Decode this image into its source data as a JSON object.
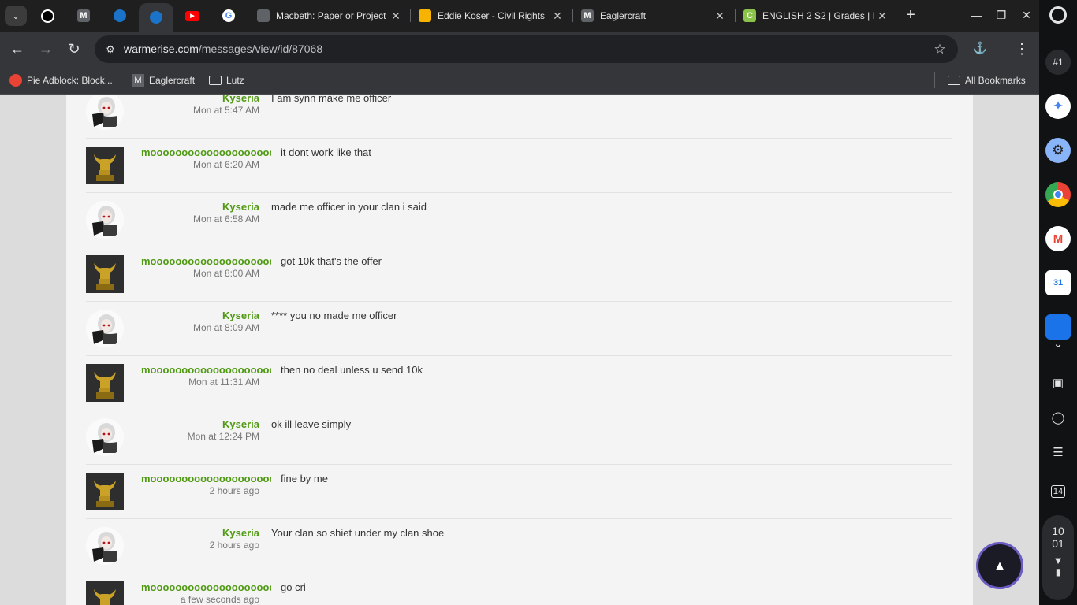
{
  "tabs": [
    {
      "title": "Macbeth: Paper or Project",
      "favicon": "classroom-icon"
    },
    {
      "title": "Eddie Koser - Civil Rights",
      "favicon": "slides-icon"
    },
    {
      "title": "Eaglercraft",
      "favicon": "eaglercraft-icon"
    },
    {
      "title": "ENGLISH 2 S2 | Grades | I",
      "favicon": "canvas-icon"
    }
  ],
  "address": {
    "host": "warmerise.com",
    "path": "/messages/view/id/87068"
  },
  "bookmarks": [
    {
      "label": "Pie Adblock: Block...",
      "icon": "pie-icon"
    },
    {
      "label": "Eaglercraft",
      "icon": "eaglercraft-icon"
    },
    {
      "label": "Lutz",
      "icon": "folder-icon"
    }
  ],
  "all_bookmarks": "All Bookmarks",
  "messages": [
    {
      "user": "Kyseria",
      "time": "Mon at 5:47 AM",
      "text": "I am synn make me officer",
      "avatar": "girl"
    },
    {
      "user": "mooooooooooooooooooooo",
      "time": "Mon at 6:20 AM",
      "text": "it dont work like that",
      "avatar": "bull"
    },
    {
      "user": "Kyseria",
      "time": "Mon at 6:58 AM",
      "text": "made me officer in your clan  i said",
      "avatar": "girl"
    },
    {
      "user": "mooooooooooooooooooooo",
      "time": "Mon at 8:00 AM",
      "text": "got 10k that's the offer",
      "avatar": "bull"
    },
    {
      "user": "Kyseria",
      "time": "Mon at 8:09 AM",
      "text": "**** you no made me officer",
      "avatar": "girl"
    },
    {
      "user": "mooooooooooooooooooooo",
      "time": "Mon at 11:31 AM",
      "text": "then no deal unless u send 10k",
      "avatar": "bull"
    },
    {
      "user": "Kyseria",
      "time": "Mon at 12:24 PM",
      "text": "ok ill leave simply",
      "avatar": "girl"
    },
    {
      "user": "mooooooooooooooooooooo",
      "time": "2 hours ago",
      "text": "fine by me",
      "avatar": "bull"
    },
    {
      "user": "Kyseria",
      "time": "2 hours ago",
      "text": "Your clan so shiet under my clan shoe",
      "avatar": "girl"
    },
    {
      "user": "mooooooooooooooooooooo",
      "time": "a few seconds ago",
      "text": "go cri",
      "avatar": "bull"
    }
  ],
  "shelf": {
    "badge": "#1",
    "calendar_date": "31",
    "task_date": "14",
    "clock_hour": "10",
    "clock_minute": "01"
  }
}
